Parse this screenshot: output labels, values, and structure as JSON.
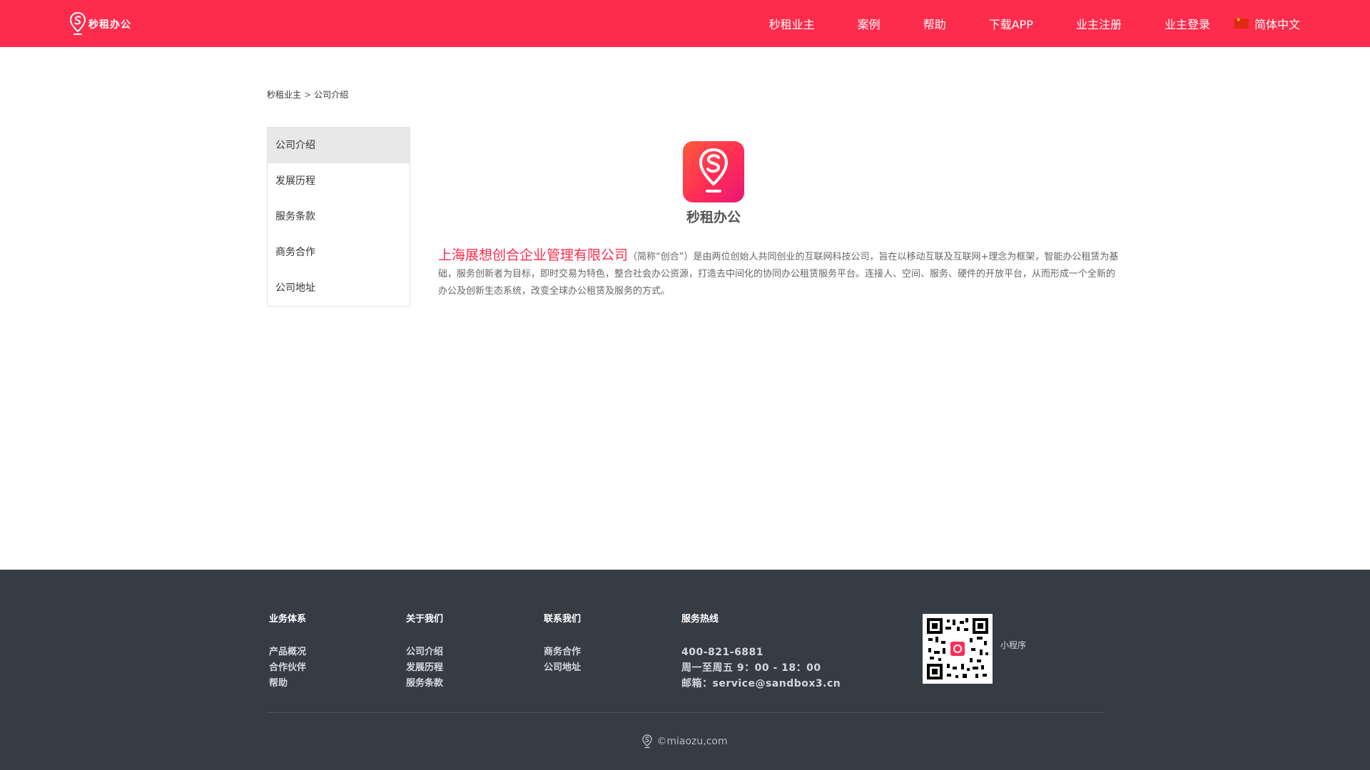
{
  "header": {
    "logo_text": "秒租办公",
    "nav": [
      "秒租业主",
      "案例",
      "帮助",
      "下载APP",
      "业主注册",
      "业主登录"
    ],
    "language": "简体中文"
  },
  "breadcrumb": {
    "root": "秒租业主",
    "separator": ">",
    "current": "公司介绍"
  },
  "sidebar": {
    "items": [
      {
        "label": "公司介绍"
      },
      {
        "label": "发展历程"
      },
      {
        "label": "服务条款"
      },
      {
        "label": "商务合作"
      },
      {
        "label": "公司地址"
      }
    ]
  },
  "main": {
    "app_name": "秒租办公",
    "company_name": "上海展想创合企业管理有限公司",
    "intro_text": "（简称“创合”）是由两位创始人共同创业的互联网科技公司，旨在以移动互联及互联网+理念为框架，智能办公租赁为基础，服务创新者为目标，即时交易为特色，整合社会办公资源，打造去中间化的协同办公租赁服务平台。连接人、空间、服务、硬件的开放平台，从而形成一个全新的办公及创新生态系统，改变全球办公租赁及服务的方式。"
  },
  "footer": {
    "columns": [
      {
        "title": "业务体系",
        "links": [
          "产品概况",
          "合作伙伴",
          "帮助"
        ]
      },
      {
        "title": "关于我们",
        "links": [
          "公司介绍",
          "发展历程",
          "服务条款"
        ]
      },
      {
        "title": "联系我们",
        "links": [
          "商务合作",
          "公司地址"
        ]
      }
    ],
    "hotline": {
      "title": "服务热线",
      "phone": "400-821-6881",
      "hours": "周一至周五 9：00 - 18：00",
      "email": "邮箱：service@sandbox3.cn"
    },
    "qr_label": "小程序",
    "copyright": "©miaozu,com"
  },
  "colors": {
    "brand": "#fd2c4d",
    "footer_bg": "#363c44"
  }
}
